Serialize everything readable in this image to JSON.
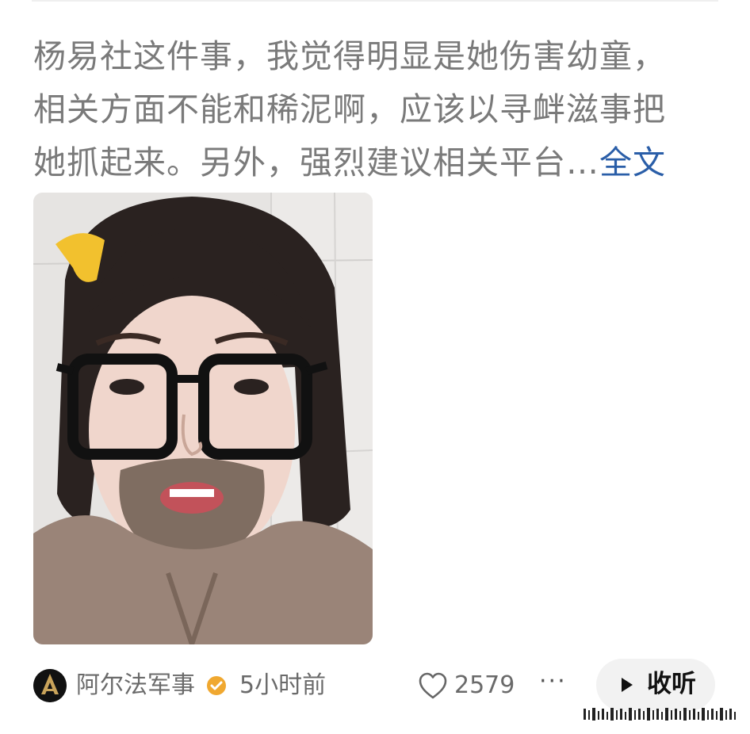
{
  "post": {
    "line1": "杨易社这件事，我觉得明显是她伤害幼童，",
    "line2": "相关方面不能和稀泥啊，应该以寻衅滋事把",
    "line3": "她抓起来。另外，强烈建议相关平台…",
    "expand_label": "全文"
  },
  "footer": {
    "author": "阿尔法军事",
    "time": "5小时前",
    "like_count": "2579",
    "more_label": "···",
    "listen_label": "收听"
  },
  "icons": {
    "avatar": "author-avatar-logo",
    "verified": "verified-badge-icon",
    "like": "heart-icon",
    "more": "more-dots-icon",
    "play": "play-icon"
  },
  "colors": {
    "body_text": "#7a7a7a",
    "link": "#2a5ea8",
    "verified_badge": "#f0a830",
    "button_bg": "#f2f2f2"
  }
}
